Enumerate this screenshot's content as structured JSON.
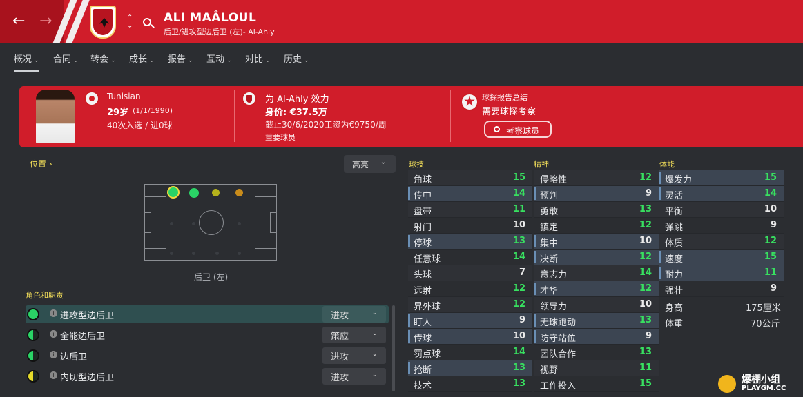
{
  "header": {
    "player_name": "ALI MAÂLOUL",
    "subtitle": "后卫/进攻型边后卫 (左)- Al-Ahly",
    "back_icon": "arrow-left-icon",
    "forward_icon": "arrow-right-icon",
    "search_icon": "search-icon",
    "brand_color": "#d01d2a"
  },
  "tabs": [
    {
      "label": "概况"
    },
    {
      "label": "合同"
    },
    {
      "label": "转会"
    },
    {
      "label": "成长"
    },
    {
      "label": "报告"
    },
    {
      "label": "互动"
    },
    {
      "label": "对比"
    },
    {
      "label": "历史"
    }
  ],
  "card": {
    "nationality": "Tunisian",
    "age_main": "29岁",
    "age_dob": "(1/1/1990)",
    "caps": "40次入选 / 进0球",
    "club_line": "为 Al-Ahly 效力",
    "value_label": "身价: ",
    "value": "€37.5万",
    "contract": "截止30/6/2020工资为€9750/周",
    "status": "重要球员",
    "scout_title": "球探报告总结",
    "scout_need": "需要球探考察",
    "scout_button": "考察球员"
  },
  "position": {
    "label": "位置",
    "highlight_button": "高亮",
    "caption": "后卫 (左)"
  },
  "roles": {
    "title": "角色和职责",
    "items": [
      {
        "name": "进攻型边后卫",
        "duty": "进攻",
        "fill": 1.0
      },
      {
        "name": "全能边后卫",
        "duty": "策应",
        "fill": 0.5
      },
      {
        "name": "边后卫",
        "duty": "进攻",
        "fill": 0.5
      },
      {
        "name": "内切型边后卫",
        "duty": "进攻",
        "fill": 0.5
      }
    ]
  },
  "attributes": {
    "technical_title": "球技",
    "mental_title": "精神",
    "physical_title": "体能",
    "technical": [
      {
        "name": "角球",
        "value": "15"
      },
      {
        "name": "传中",
        "value": "14"
      },
      {
        "name": "盘带",
        "value": "11"
      },
      {
        "name": "射门",
        "value": "10"
      },
      {
        "name": "停球",
        "value": "13"
      },
      {
        "name": "任意球",
        "value": "14"
      },
      {
        "name": "头球",
        "value": "7"
      },
      {
        "name": "远射",
        "value": "12"
      },
      {
        "name": "界外球",
        "value": "12"
      },
      {
        "name": "盯人",
        "value": "9"
      },
      {
        "name": "传球",
        "value": "10"
      },
      {
        "name": "罚点球",
        "value": "14"
      },
      {
        "name": "抢断",
        "value": "13"
      },
      {
        "name": "技术",
        "value": "13"
      }
    ],
    "mental": [
      {
        "name": "侵略性",
        "value": "12"
      },
      {
        "name": "预判",
        "value": "9"
      },
      {
        "name": "勇敢",
        "value": "13"
      },
      {
        "name": "镇定",
        "value": "12"
      },
      {
        "name": "集中",
        "value": "10"
      },
      {
        "name": "决断",
        "value": "12"
      },
      {
        "name": "意志力",
        "value": "14"
      },
      {
        "name": "才华",
        "value": "12"
      },
      {
        "name": "领导力",
        "value": "10"
      },
      {
        "name": "无球跑动",
        "value": "13"
      },
      {
        "name": "防守站位",
        "value": "9"
      },
      {
        "name": "团队合作",
        "value": "13"
      },
      {
        "name": "视野",
        "value": "11"
      },
      {
        "name": "工作投入",
        "value": "15"
      }
    ],
    "physical": [
      {
        "name": "爆发力",
        "value": "15"
      },
      {
        "name": "灵活",
        "value": "14"
      },
      {
        "name": "平衡",
        "value": "10"
      },
      {
        "name": "弹跳",
        "value": "9"
      },
      {
        "name": "体质",
        "value": "12"
      },
      {
        "name": "速度",
        "value": "15"
      },
      {
        "name": "耐力",
        "value": "11"
      },
      {
        "name": "强壮",
        "value": "9"
      }
    ],
    "height_label": "身高",
    "height": "175厘米",
    "weight_label": "体重",
    "weight": "70公斤"
  },
  "watermark": {
    "text": "爆棚小组",
    "site": "PLAYGM.CC"
  }
}
